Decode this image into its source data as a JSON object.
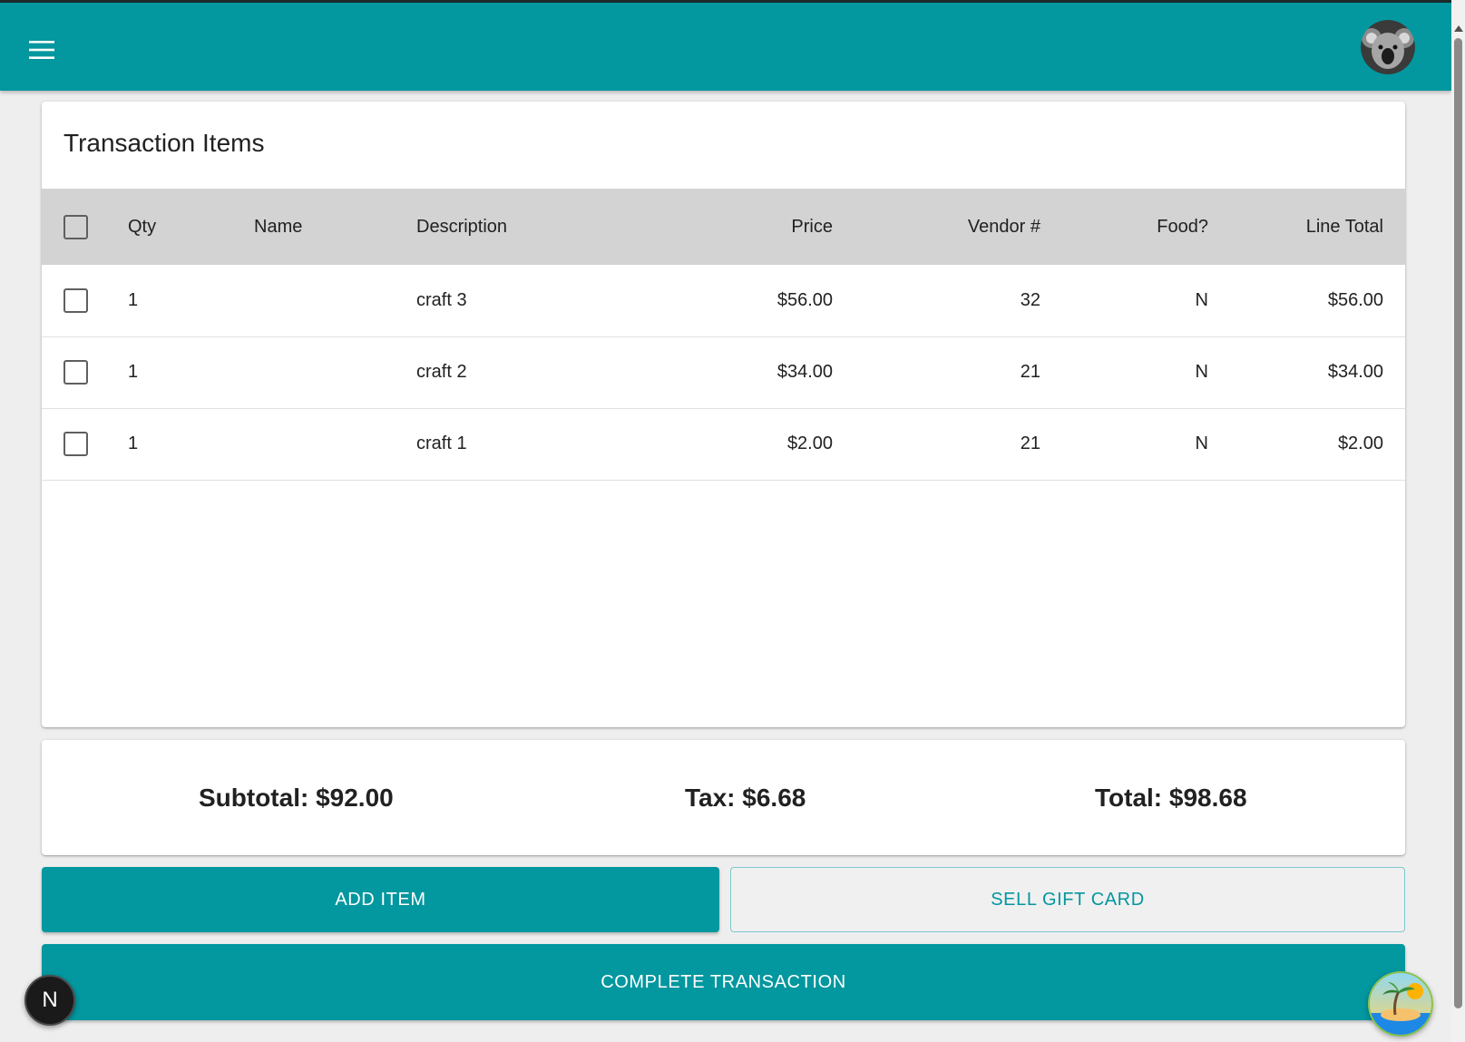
{
  "header": {
    "menu_icon": "hamburger-menu-icon",
    "avatar_icon": "koala-avatar"
  },
  "items_card": {
    "title": "Transaction Items",
    "columns": {
      "qty": "Qty",
      "name": "Name",
      "description": "Description",
      "price": "Price",
      "vendor": "Vendor #",
      "food": "Food?",
      "line_total": "Line Total"
    },
    "rows": [
      {
        "qty": "1",
        "name": "",
        "description": "craft 3",
        "price": "$56.00",
        "vendor": "32",
        "food": "N",
        "line_total": "$56.00"
      },
      {
        "qty": "1",
        "name": "",
        "description": "craft 2",
        "price": "$34.00",
        "vendor": "21",
        "food": "N",
        "line_total": "$34.00"
      },
      {
        "qty": "1",
        "name": "",
        "description": "craft 1",
        "price": "$2.00",
        "vendor": "21",
        "food": "N",
        "line_total": "$2.00"
      }
    ]
  },
  "totals": {
    "subtotal": "Subtotal: $92.00",
    "tax": "Tax: $6.68",
    "total": "Total: $98.68"
  },
  "actions": {
    "add_item": "ADD ITEM",
    "sell_gift_card": "SELL GIFT CARD",
    "complete_transaction": "COMPLETE TRANSACTION"
  },
  "badges": {
    "n_badge": "N"
  },
  "colors": {
    "primary": "#03979f",
    "header_row": "#d3d3d3",
    "background": "#eeeeee"
  }
}
